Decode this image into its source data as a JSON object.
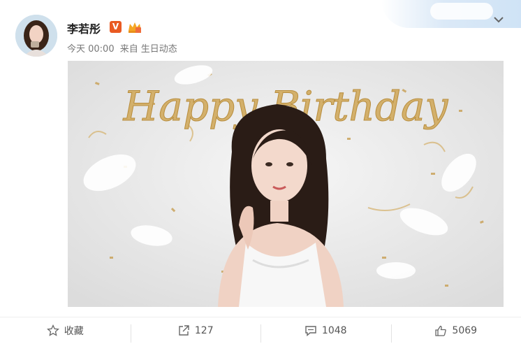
{
  "post": {
    "author": "李若彤",
    "verified_badge": "V",
    "time": "今天 00:00",
    "source_prefix": "来自",
    "source": "生日动态",
    "image_text": "Happy Birthday"
  },
  "actions": {
    "favorite_label": "收藏",
    "repost_count": "127",
    "comment_count": "1048",
    "like_count": "5069"
  },
  "colors": {
    "accent_badge": "#e95a22",
    "gold": "#c9a25a",
    "background": "#ffffff"
  },
  "icons": {
    "favorite": "star-outline-icon",
    "repost": "share-arrow-icon",
    "comment": "comment-bubble-icon",
    "like": "thumbs-up-icon",
    "menu": "chevron-down-icon"
  }
}
